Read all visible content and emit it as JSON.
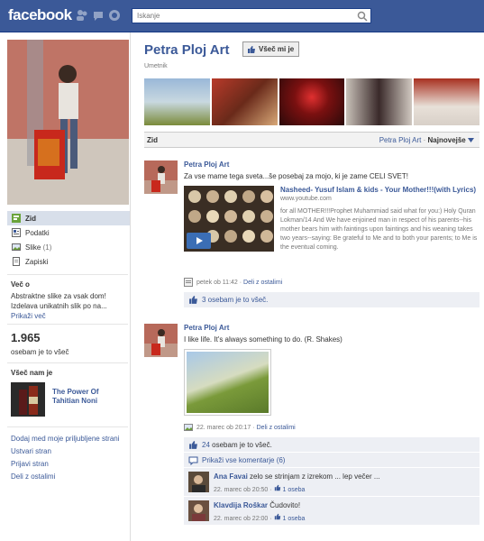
{
  "header": {
    "logo": "facebook",
    "search_placeholder": "Iskanje"
  },
  "sidebar": {
    "nav": [
      {
        "label": "Zid",
        "active": true
      },
      {
        "label": "Podatki"
      },
      {
        "label": "Slike",
        "count": "(1)"
      },
      {
        "label": "Zapiski"
      }
    ],
    "about_title": "Več o",
    "about_text": "Abstraktne slike za vsak dom! Izdelava unikatnih slik po na...",
    "about_more": "Prikaži več",
    "likes_count": "1.965",
    "likes_text": "osebam je to všeč",
    "liked_title": "Všeč nam je",
    "liked_page": "The Power Of Tahitian Noni",
    "footer_links": [
      "Dodaj med moje priljubljene strani",
      "Ustvari stran",
      "Prijavi stran",
      "Deli z ostalimi"
    ]
  },
  "page": {
    "title": "Petra Ploj Art",
    "like_button": "Všeč mi je",
    "category": "Umetnik"
  },
  "wall": {
    "label": "Zid",
    "filter_name": "Petra Ploj Art",
    "separator": " · ",
    "filter_sort": "Najnovejše"
  },
  "stories": [
    {
      "author": "Petra Ploj Art",
      "message": "Za vse mame tega sveta...še posebaj za mojo, ki je zame CELI SVET!",
      "attachment": {
        "title": "Nasheed- Yusuf Islam & kids - Your Mother!!!(with Lyrics)",
        "url": "www.youtube.com",
        "description": "for all MOTHER!!!Prophet Muhammiad said what for you:) Holy Quran Lokman/14 And We have enjoined man in respect of his parents--his mother bears him with faintings upon faintings and his weaning takes two years--saying: Be grateful to Me and to both your parents; to Me is the eventual coming."
      },
      "time": "petek ob 11:42",
      "share": "Deli z ostalimi",
      "likes": "3 osebam je to všeč."
    },
    {
      "author": "Petra Ploj Art",
      "message": "I like life. It's always something to do. (R. Shakes)",
      "time": "22. marec ob 20:17",
      "share": "Deli z ostalimi",
      "likes_num": "24",
      "likes_rest": "osebam je to všeč.",
      "show_comments": "Prikaži vse komentarje (6)",
      "comments": [
        {
          "author": "Ana Favai",
          "text": "zelo se strinjam z izrekom ... lep večer ...",
          "time": "22. marec ob 20:50",
          "likes": "1 oseba"
        },
        {
          "author": "Klavdija Roškar",
          "text": "Čudovito!",
          "time": "22. marec ob 22:00",
          "likes": "1 oseba"
        }
      ]
    }
  ],
  "colors": {
    "brand": "#3b5998",
    "nav_active": "#d8dfea",
    "feedback_bg": "#edeff4"
  }
}
